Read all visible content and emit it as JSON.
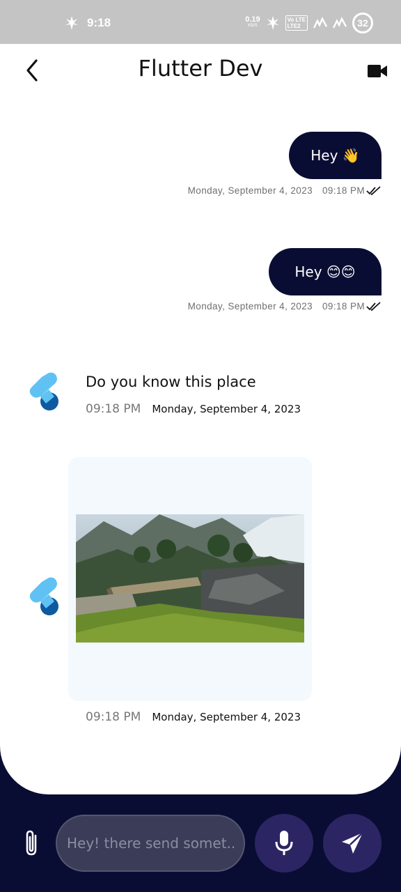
{
  "status_bar": {
    "time": "9:18",
    "net_speed": "0.19",
    "net_unit": "KB/S",
    "volte_top": "Vo LTE",
    "volte_bottom": "LTE2",
    "battery": "32"
  },
  "header": {
    "title": "Flutter Dev",
    "back_icon": "chevron-left-icon",
    "video_icon": "video-camera-icon"
  },
  "messages": {
    "sent": [
      {
        "text": "Hey 👋",
        "date": "Monday, September 4, 2023",
        "time": "09:18 PM"
      },
      {
        "text": "Hey 😊😊",
        "date": "Monday, September 4, 2023",
        "time": "09:18 PM"
      }
    ],
    "received": [
      {
        "text": "Do you know this place",
        "time": "09:18 PM",
        "date": "Monday, September 4, 2023"
      },
      {
        "type": "image",
        "image_icon": "landscape-photo",
        "time": "09:18 PM",
        "date": "Monday, September 4, 2023"
      }
    ]
  },
  "composer": {
    "placeholder": "Hey! there send somet...",
    "attach_icon": "paperclip-icon",
    "mic_icon": "microphone-icon",
    "send_icon": "send-icon"
  },
  "colors": {
    "primary": "#0a0d33",
    "bubble_button": "#2c2564",
    "input_bg": "#3a3c58",
    "status_bar": "#c4c4c4",
    "logo_light": "#5fc2f3",
    "logo_dark": "#0d5aa0"
  }
}
